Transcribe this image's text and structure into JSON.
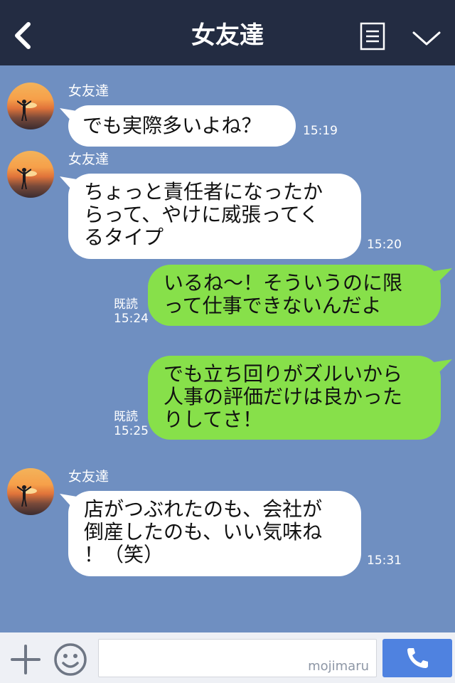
{
  "header": {
    "title": "女友達",
    "icons": [
      "back-chevron-icon",
      "menu-icon",
      "chevron-down-icon"
    ]
  },
  "messages": [
    {
      "sender": "女友達",
      "direction": "incoming",
      "lines": [
        "でも実際多いよね？"
      ],
      "time": "15:19"
    },
    {
      "sender": "女友達",
      "direction": "incoming",
      "lines": [
        "ちょっと責任者になったか",
        "らって、やけに威張ってく",
        "るタイプ"
      ],
      "time": "15:20"
    },
    {
      "direction": "outgoing",
      "read": "既読",
      "time": "15:24",
      "lines": [
        "いるね〜！そういうのに限",
        "って仕事できないんだよ"
      ]
    },
    {
      "direction": "outgoing",
      "read": "既読",
      "time": "15:25",
      "lines": [
        "でも立ち回りがズルいから",
        "人事の評価だけは良かった",
        "りしてさ！"
      ]
    },
    {
      "sender": "女友達",
      "direction": "incoming",
      "lines": [
        "店がつぶれたのも、会社が",
        "倒産したのも、いい気味ね",
        "！（笑）"
      ],
      "time": "15:31"
    }
  ],
  "footer": {
    "input_value": "",
    "watermark": "mojimaru",
    "icons": [
      "plus-icon",
      "emoji-icon",
      "phone-icon"
    ]
  },
  "colors": {
    "header_bg": "#232c42",
    "chat_bg": "#6f8fc1",
    "incoming_bubble": "#ffffff",
    "outgoing_bubble": "#87e04a",
    "send_button": "#4f82e0"
  }
}
